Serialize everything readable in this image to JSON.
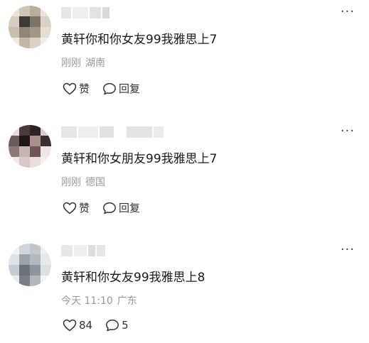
{
  "comments": [
    {
      "text": "黄轩你和你女友99我雅思上7",
      "time": "刚刚",
      "location": "湖南",
      "like_label": "赞",
      "reply_label": "回复"
    },
    {
      "text": "黄轩和你女朋友99我雅思上7",
      "time": "刚刚",
      "location": "德国",
      "like_label": "赞",
      "reply_label": "回复"
    },
    {
      "text": "黄轩和你女友99我雅思上8",
      "time": "今天 11:10",
      "location": "广东",
      "like_label": "84",
      "reply_label": "5"
    }
  ],
  "more_label": "···",
  "icons": {
    "like": "heart-icon",
    "reply": "comment-bubble-icon",
    "more": "more-dots-icon"
  },
  "colors": {
    "meta_text": "#999999",
    "comment_text": "#1a1a1a"
  }
}
